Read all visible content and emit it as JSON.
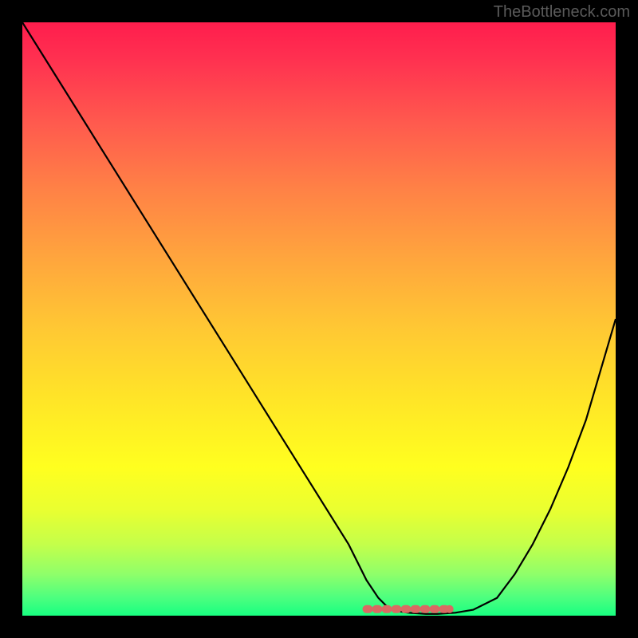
{
  "watermark": "TheBottleneck.com",
  "chart_data": {
    "type": "line",
    "title": "",
    "xlabel": "",
    "ylabel": "",
    "xlim": [
      0,
      100
    ],
    "ylim": [
      0,
      100
    ],
    "grid": false,
    "series": [
      {
        "name": "bottleneck-curve",
        "x": [
          0,
          5,
          10,
          15,
          20,
          25,
          30,
          35,
          40,
          45,
          50,
          55,
          58,
          60,
          62,
          65,
          68,
          70,
          73,
          76,
          80,
          83,
          86,
          89,
          92,
          95,
          100
        ],
        "y": [
          100,
          92,
          84,
          76,
          68,
          60,
          52,
          44,
          36,
          28,
          20,
          12,
          6,
          3,
          1,
          0.5,
          0.3,
          0.3,
          0.5,
          1,
          3,
          7,
          12,
          18,
          25,
          33,
          50
        ]
      }
    ],
    "annotations": [
      {
        "name": "plateau-dash-left-end",
        "x": 58,
        "y": 1.1
      },
      {
        "name": "plateau-dash-right-end",
        "x": 72,
        "y": 1.1
      }
    ],
    "gradient_stops": [
      {
        "pct": 0,
        "color": "#ff1d4d"
      },
      {
        "pct": 17,
        "color": "#ff5a4e"
      },
      {
        "pct": 40,
        "color": "#ffa63d"
      },
      {
        "pct": 64,
        "color": "#ffe627"
      },
      {
        "pct": 82,
        "color": "#eaff30"
      },
      {
        "pct": 93,
        "color": "#8fff6a"
      },
      {
        "pct": 100,
        "color": "#18ff80"
      }
    ]
  }
}
